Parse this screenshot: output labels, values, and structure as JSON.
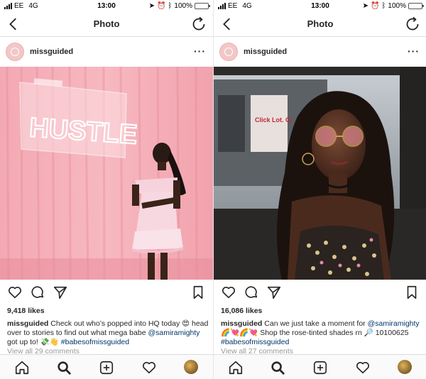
{
  "screens": [
    {
      "status": {
        "carrier": "EE",
        "network": "4G",
        "time": "13:00",
        "battery_percent": "100%",
        "battery_level": 1.0
      },
      "nav": {
        "title": "Photo"
      },
      "post": {
        "username": "missguided",
        "more_label": "···",
        "likes": "9,418 likes",
        "caption_user": "missguided",
        "caption_text": " Check out who’s popped into HQ today 😍 head over to stories to find out what mega babe ",
        "caption_mention": "@samiramighty",
        "caption_after_mention": " got up to! 💸👋 ",
        "caption_hashtag": "#babesofmissguided",
        "view_all": "View all 29 comments",
        "sign_text": "HUSTLE"
      }
    },
    {
      "status": {
        "carrier": "EE",
        "network": "4G",
        "time": "13:00",
        "battery_percent": "100%",
        "battery_level": 1.0
      },
      "nav": {
        "title": "Photo"
      },
      "post": {
        "username": "missguided",
        "more_label": "···",
        "likes": "16,086 likes",
        "caption_user": "missguided",
        "caption_text": " Can we just take a moment for ",
        "caption_mention": "@samiramighty",
        "caption_after_mention": " 🌈💘🌈💘 Shop the rose-tinted shades rn 🔎 10100625 ",
        "caption_hashtag": "#babesofmissguided",
        "view_all": "View all 27 comments",
        "shop_sign": "Click Lot. Cl"
      }
    }
  ],
  "colors": {
    "link": "#003569",
    "battery": "#4cd964",
    "accent_pink": "#f08c9c"
  },
  "icons": {
    "nav": [
      "back-chevron-icon",
      "refresh-icon"
    ],
    "actions": [
      "heart-icon",
      "comment-icon",
      "share-icon",
      "bookmark-icon"
    ],
    "tabbar": [
      "home-icon",
      "search-icon",
      "add-icon",
      "activity-heart-icon",
      "profile-avatar-icon"
    ]
  }
}
